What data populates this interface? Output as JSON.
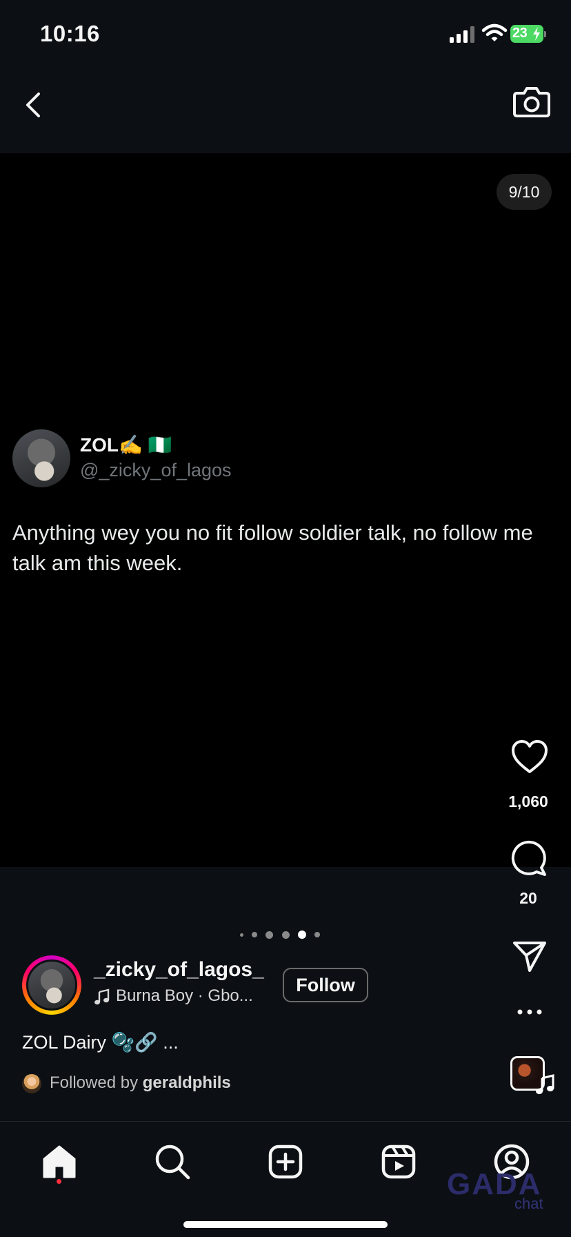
{
  "status_bar": {
    "time": "10:16",
    "battery": "23"
  },
  "post": {
    "slide_counter": "9/10",
    "tweet": {
      "name": "ZOL✍️ 🇳🇬",
      "handle": "@_zicky_of_lagos",
      "text": "Anything wey you no fit follow soldier talk, no follow me talk am this week."
    },
    "likes": "1,060",
    "comments": "20",
    "author": {
      "username": "_zicky_of_lagos_",
      "music": "Burna Boy · Gbo...",
      "follow_label": "Follow"
    },
    "caption": "ZOL Dairy 🫧🔗 ...",
    "followed_by_prefix": "Followed by",
    "followed_by_user": "geraldphils"
  },
  "watermark": {
    "main": "GADA",
    "sub": "chat"
  },
  "icons": {
    "back": "chevron-left-icon",
    "camera": "camera-icon",
    "like": "heart-icon",
    "comment": "comment-icon",
    "share": "send-icon",
    "more": "more-icon",
    "nav": [
      "home-icon",
      "search-icon",
      "create-icon",
      "reels-icon",
      "profile-icon"
    ]
  },
  "colors": {
    "accent_red": "#ff3040",
    "battery_green": "#4cd964"
  }
}
